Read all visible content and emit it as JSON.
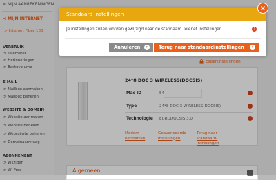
{
  "sidebar": {
    "top_link": "< MIJN AANREKENINGEN",
    "heading": "< MIJN INTERNET",
    "subheading": "> Internet Fiber 100",
    "sections": [
      {
        "title": "VERBRUIK",
        "items": [
          "> Telemeter",
          "> Herinneringen",
          "> Bastovolume"
        ]
      },
      {
        "title": "E-MAIL",
        "items": [
          "> Mailbox aanmaken",
          "> Mailbox beheren"
        ]
      },
      {
        "title": "WEBSITE & DOMEIN",
        "items": [
          "> Website aanmaken",
          "> Website beheren",
          "> Webruimte beheren",
          "> Domeinaanvraag"
        ]
      },
      {
        "title": "ABONNEMENT",
        "items": [
          "> Wijzigen",
          "> Wi-Free"
        ]
      }
    ]
  },
  "expert_link": "Expertinstellingen",
  "device": {
    "title": "24*8 DOC 3 WIRELESS(DOCSIS)",
    "rows": [
      {
        "label": "Mac ID",
        "value": "54:"
      },
      {
        "label": "Type",
        "value": "24*8 DOC 3 WIRELESS(DOCSIS)"
      },
      {
        "label": "Technologie",
        "value": "EURODOCSIS 3.0"
      }
    ],
    "links": {
      "restart": [
        "Modem",
        "herstarten"
      ],
      "advanced": [
        "Geavanceerde",
        "instellingen"
      ],
      "reset": [
        "Terug naar",
        "standaard-",
        "instellingen"
      ]
    }
  },
  "panel2": {
    "title": "Algemeen"
  },
  "modal": {
    "title": "Standaard instellingen",
    "message": "Je instellingen zullen worden gewijzigd naar de standaard Telenet instellingen",
    "cancel_label": "Annuleren",
    "confirm_label": "Terug naar standaardinstellingen",
    "close_symbol": "×"
  },
  "colors": {
    "accent": "#e8601c",
    "header": "#e8a70e",
    "grey_button": "#8a8a8a"
  }
}
